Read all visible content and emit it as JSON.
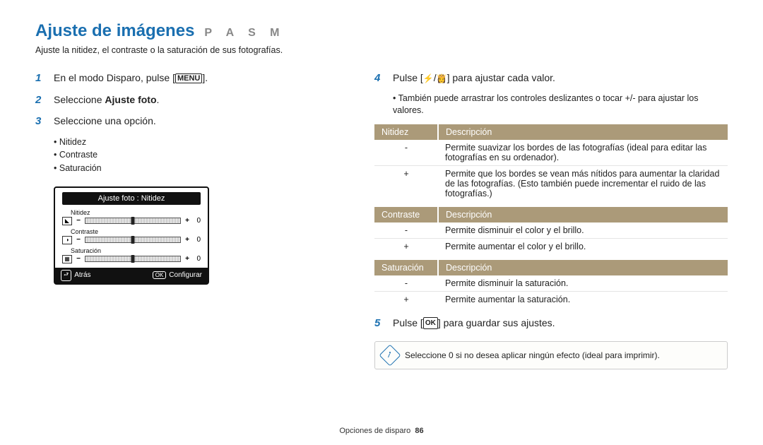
{
  "title": "Ajuste de imágenes",
  "modes": "P A S M",
  "subtitle": "Ajuste la nitidez, el contraste o la saturación de sus fotografías.",
  "steps_left": {
    "s1_pre": "En el modo Disparo, pulse [",
    "s1_btn": "MENU",
    "s1_post": "].",
    "s2_pre": "Seleccione ",
    "s2_bold": "Ajuste foto",
    "s2_post": ".",
    "s3": "Seleccione una opción.",
    "bullets": [
      "Nitidez",
      "Contraste",
      "Saturación"
    ]
  },
  "screen": {
    "header": "Ajuste foto : Nitidez",
    "rows": [
      {
        "label": "Nitidez",
        "value": "0"
      },
      {
        "label": "Contraste",
        "value": "0"
      },
      {
        "label": "Saturación",
        "value": "0"
      }
    ],
    "back_label": "Atrás",
    "ok_label": "Configurar",
    "ok_btn": "OK"
  },
  "steps_right": {
    "s4_pre": "Pulse [",
    "s4_post": "] para ajustar cada valor.",
    "s4_bullet": "También puede arrastrar los controles deslizantes o tocar +/- para ajustar los valores.",
    "s5_pre": "Pulse [",
    "s5_ok": "OK",
    "s5_post": "] para guardar sus ajustes."
  },
  "tables": {
    "nitidez": {
      "h1": "Nitidez",
      "h2": "Descripción",
      "rows": [
        {
          "k": "-",
          "v": "Permite suavizar los bordes de las fotografías (ideal para editar las fotografías en su ordenador)."
        },
        {
          "k": "+",
          "v": "Permite que los bordes se vean más nítidos para aumentar la claridad de las fotografías. (Esto también puede incrementar el ruido de las fotografías.)"
        }
      ]
    },
    "contraste": {
      "h1": "Contraste",
      "h2": "Descripción",
      "rows": [
        {
          "k": "-",
          "v": "Permite disminuir el color y el brillo."
        },
        {
          "k": "+",
          "v": "Permite aumentar el color y el brillo."
        }
      ]
    },
    "saturacion": {
      "h1": "Saturación",
      "h2": "Descripción",
      "rows": [
        {
          "k": "-",
          "v": "Permite disminuir la saturación."
        },
        {
          "k": "+",
          "v": "Permite aumentar la saturación."
        }
      ]
    }
  },
  "note": "Seleccione 0 si no desea aplicar ningún efecto (ideal para imprimir).",
  "footer_label": "Opciones de disparo",
  "footer_page": "86"
}
